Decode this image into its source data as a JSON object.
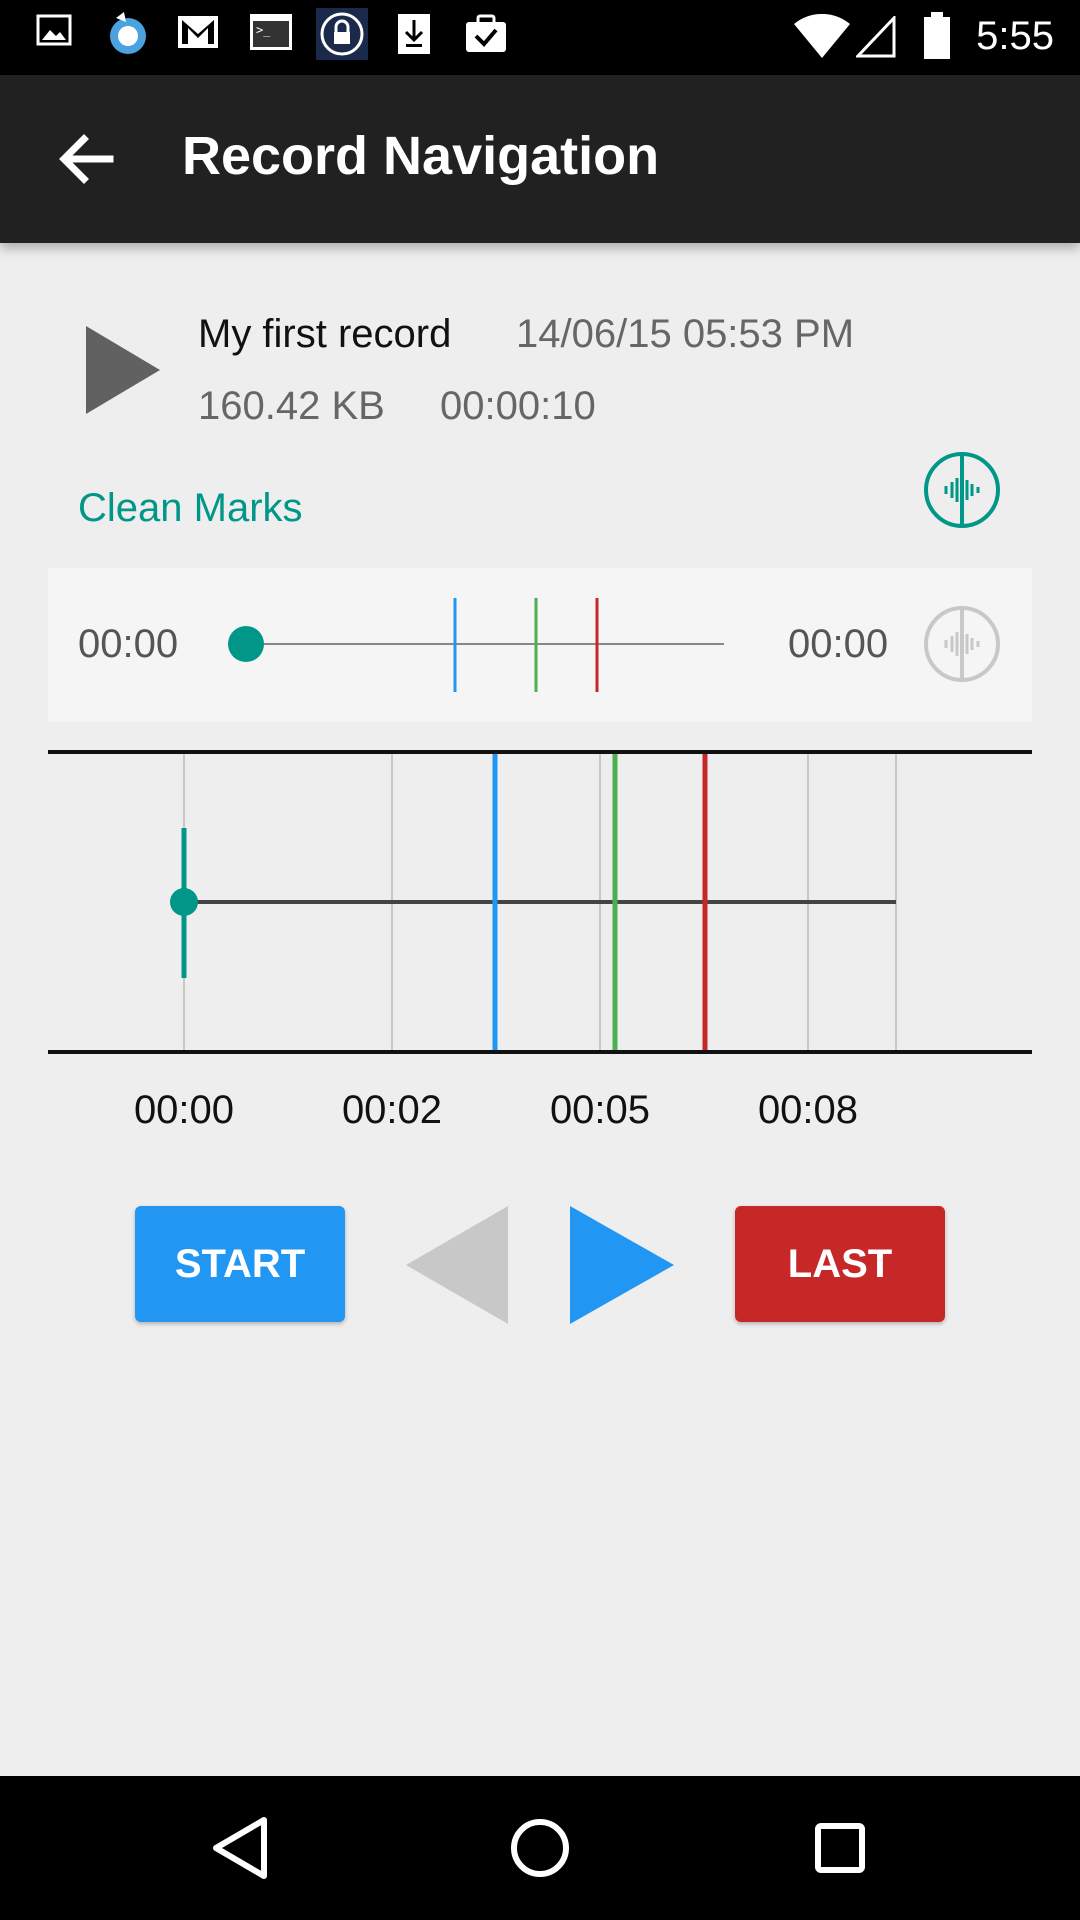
{
  "status_bar": {
    "time": "5:55",
    "left_icons": [
      "image-icon",
      "browser-icon",
      "gmail-icon",
      "terminal-icon",
      "lock-icon",
      "download-icon",
      "clipboard-check-icon"
    ],
    "right_icons": [
      "wifi-icon",
      "cell-signal-icon",
      "battery-icon"
    ]
  },
  "app_bar": {
    "title": "Record Navigation",
    "back_icon": "arrow-left-icon"
  },
  "record": {
    "name": "My first record",
    "date": "14/06/15 05:53 PM",
    "size": "160.42 KB",
    "duration": "00:00:10"
  },
  "clean_marks_label": "Clean Marks",
  "player": {
    "current_time": "00:00",
    "total_time": "00:00",
    "position_fraction": 0,
    "marks_fraction": [
      0.42,
      0.58,
      0.7
    ],
    "mark_colors": [
      "#2196f3",
      "#4caf50",
      "#c62828"
    ]
  },
  "timeline": {
    "tick_labels": [
      "00:00",
      "00:02",
      "00:05",
      "00:08"
    ]
  },
  "controls": {
    "start_label": "START",
    "last_label": "LAST",
    "prev_disabled": true,
    "next_enabled": true
  },
  "colors": {
    "accent": "#009688",
    "start": "#2196f3",
    "last": "#c62828",
    "app_bar": "#212121"
  },
  "nav_bar": {
    "icons": [
      "back-triangle-icon",
      "home-circle-icon",
      "recents-square-icon"
    ]
  }
}
